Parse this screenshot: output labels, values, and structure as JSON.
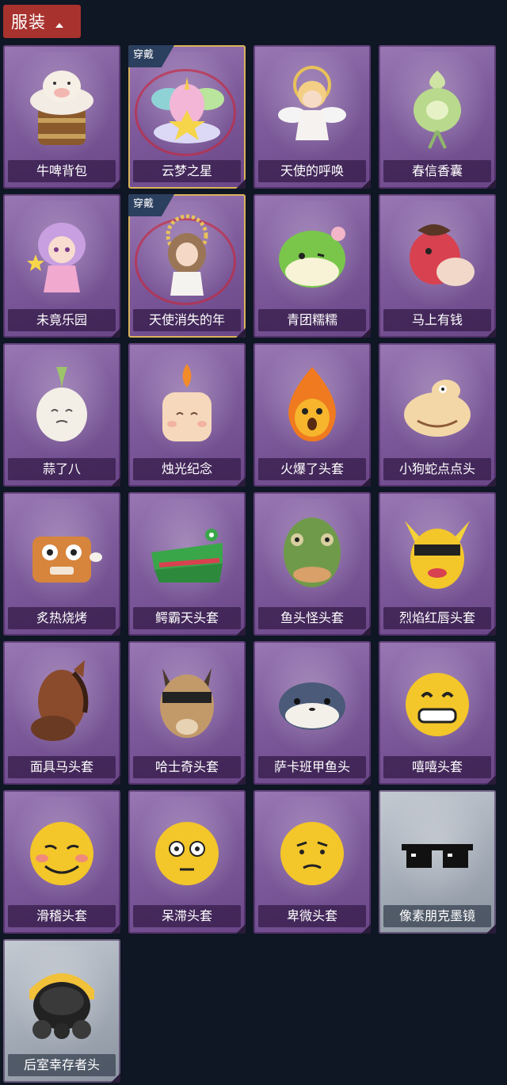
{
  "header": {
    "title": "服装",
    "chevron_icon": "chevron-up-icon"
  },
  "colors": {
    "header_bg": "#a8322e",
    "card_purple": "#7e5b9c",
    "card_grey": "#a5adb8",
    "worn_badge": "#2b3f5e",
    "page_bg": "#0f1624"
  },
  "items": [
    {
      "name": "牛啤背包",
      "icon": "beer-cow-backpack-icon",
      "worn": false,
      "style": "purple"
    },
    {
      "name": "云梦之星",
      "icon": "unicorn-star-icon",
      "worn": true,
      "badge": "穿戴",
      "style": "purple"
    },
    {
      "name": "天使的呼唤",
      "icon": "angel-doll-icon",
      "worn": false,
      "style": "purple"
    },
    {
      "name": "春信香囊",
      "icon": "sachet-icon",
      "worn": false,
      "style": "purple"
    },
    {
      "name": "未竟乐园",
      "icon": "fairy-girl-icon",
      "worn": false,
      "style": "purple"
    },
    {
      "name": "天使消失的年",
      "icon": "angel-girl-icon",
      "worn": true,
      "badge": "穿戴",
      "style": "purple"
    },
    {
      "name": "青团糯糯",
      "icon": "green-rice-ball-icon",
      "worn": false,
      "style": "purple"
    },
    {
      "name": "马上有钱",
      "icon": "horse-head-icon",
      "worn": false,
      "style": "purple"
    },
    {
      "name": "蒜了八",
      "icon": "garlic-icon",
      "worn": false,
      "style": "purple"
    },
    {
      "name": "烛光纪念",
      "icon": "candle-icon",
      "worn": false,
      "style": "purple"
    },
    {
      "name": "火爆了头套",
      "icon": "fire-head-icon",
      "worn": false,
      "style": "purple"
    },
    {
      "name": "小狗蛇点点头",
      "icon": "snake-dog-icon",
      "worn": false,
      "style": "purple"
    },
    {
      "name": "炙热烧烤",
      "icon": "bbq-meat-icon",
      "worn": false,
      "style": "purple"
    },
    {
      "name": "鳄霸天头套",
      "icon": "crocodile-head-icon",
      "worn": false,
      "style": "purple"
    },
    {
      "name": "鱼头怪头套",
      "icon": "fish-head-icon",
      "worn": false,
      "style": "purple"
    },
    {
      "name": "烈焰红唇头套",
      "icon": "pikachu-mask-icon",
      "worn": false,
      "style": "purple"
    },
    {
      "name": "面具马头套",
      "icon": "horse-mask-icon",
      "worn": false,
      "style": "purple"
    },
    {
      "name": "哈士奇头套",
      "icon": "husky-mask-icon",
      "worn": false,
      "style": "purple"
    },
    {
      "name": "萨卡班甲鱼头",
      "icon": "sacabambaspis-icon",
      "worn": false,
      "style": "purple"
    },
    {
      "name": "嘻嘻头套",
      "icon": "grin-emoji-icon",
      "worn": false,
      "style": "purple"
    },
    {
      "name": "滑稽头套",
      "icon": "funny-emoji-icon",
      "worn": false,
      "style": "purple"
    },
    {
      "name": "呆滞头套",
      "icon": "stunned-emoji-icon",
      "worn": false,
      "style": "purple"
    },
    {
      "name": "卑微头套",
      "icon": "humble-emoji-icon",
      "worn": false,
      "style": "purple"
    },
    {
      "name": "像素朋克墨镜",
      "icon": "pixel-sunglasses-icon",
      "worn": false,
      "style": "grey"
    },
    {
      "name": "后室幸存者头",
      "icon": "gas-mask-helmet-icon",
      "worn": false,
      "style": "grey"
    }
  ]
}
